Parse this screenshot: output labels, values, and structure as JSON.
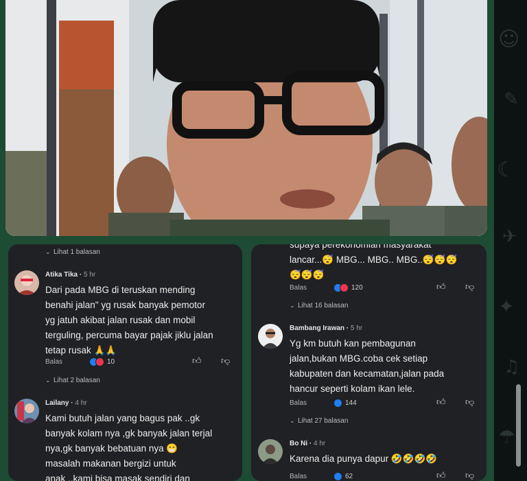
{
  "left_panel": {
    "top_replies": "Lihat 1 balasan",
    "comments": [
      {
        "name": "Atika Tika",
        "time": "5 hr",
        "lines": [
          "Dari pada MBG di teruskan mending",
          "benahi jalan\" yg rusak banyak pemotor",
          "yg jatuh akibat jalan rusak dan mobil",
          "terguling, percuma bayar pajak jiklu jalan",
          "tetap rusak 🙏🙏"
        ],
        "reply_label": "Balas",
        "reaction_count": "10",
        "replies": "Lihat 2 balasan"
      },
      {
        "name": "Lailany",
        "time": "4 hr",
        "lines": [
          "Kami butuh jalan yang bagus pak ..gk",
          "banyak kolam nya ,gk banyak jalan terjal",
          "nya,gk banyak bebatuan nya 😁",
          "masalah makanan bergizi untuk",
          "anak ..kami bisa masak sendiri dan"
        ]
      }
    ]
  },
  "right_panel": {
    "top_lines": [
      "supaya perekonomian masyarakat",
      "lancar...😴 MBG... MBG.. MBG..😴😴😴",
      "😴😴😴"
    ],
    "top_reply_label": "Balas",
    "top_reaction_count": "120",
    "top_replies": "Lihat 16 balasan",
    "comments": [
      {
        "name": "Bambang Irawan",
        "time": "5 hr",
        "lines": [
          "Yg km butuh kan pembagunan",
          "jalan,bukan MBG.coba cek setiap",
          "kabupaten dan kecamatan,jalan pada",
          "hancur seperti kolam ikan lele."
        ],
        "reply_label": "Balas",
        "reaction_count": "144",
        "replies": "Lihat 27 balasan"
      },
      {
        "name": "Bo Ni",
        "time": "4 hr",
        "lines": [
          "Karena dia punya dapur 🤣🤣🤣🤣"
        ],
        "reply_label": "Balas",
        "reaction_count": "62"
      }
    ]
  },
  "icons": {
    "like": "thumbs-up-icon",
    "dislike": "thumbs-down-icon",
    "like_reaction": "like-reaction-icon",
    "love_reaction": "love-reaction-icon",
    "chevron": "chevron-down-icon"
  },
  "colors": {
    "background_frame": "#1e4b33",
    "panel": "#202124",
    "like_blue": "#1f7ef0",
    "heart_red": "#f0334f"
  }
}
